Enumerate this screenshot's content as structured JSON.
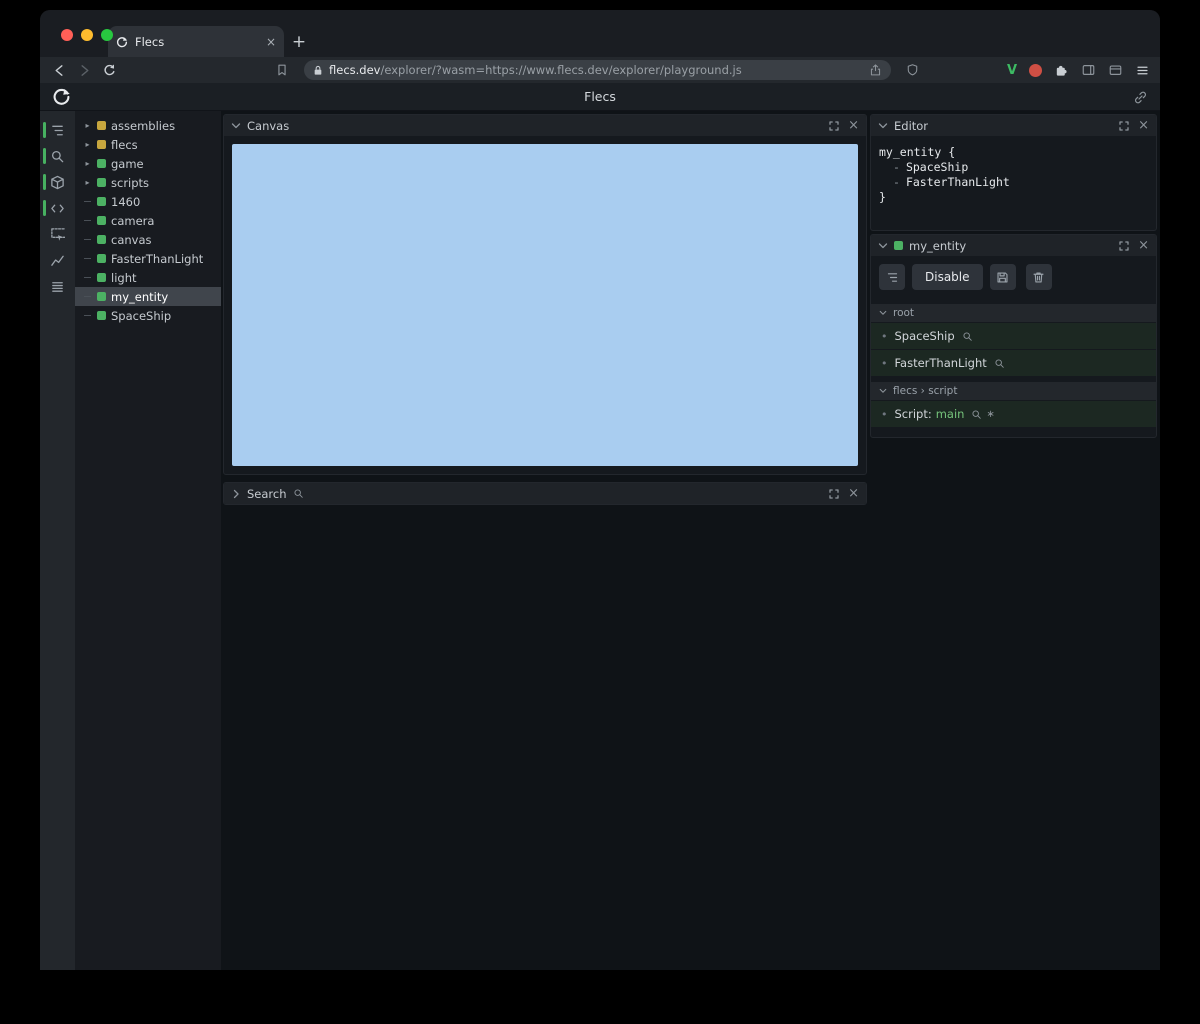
{
  "icons": {
    "close": "×",
    "new_tab": "+",
    "bullet": "•",
    "asterisk": "∗",
    "chevron_right": "›",
    "chevron_down": "⌄"
  },
  "browser": {
    "tab_title": "Flecs",
    "url_domain": "flecs.dev",
    "url_rest": "/explorer/?wasm=https://www.flecs.dev/explorer/playground.js"
  },
  "app": {
    "title": "Flecs"
  },
  "tree": {
    "items": [
      {
        "label": "assemblies",
        "color": "#c7a63e",
        "expandable": true
      },
      {
        "label": "flecs",
        "color": "#c7a63e",
        "expandable": true
      },
      {
        "label": "game",
        "color": "#4cb163",
        "expandable": true
      },
      {
        "label": "scripts",
        "color": "#4cb163",
        "expandable": true
      },
      {
        "label": "1460",
        "color": "#4cb163",
        "expandable": false
      },
      {
        "label": "camera",
        "color": "#4cb163",
        "expandable": false
      },
      {
        "label": "canvas",
        "color": "#4cb163",
        "expandable": false
      },
      {
        "label": "FasterThanLight",
        "color": "#4cb163",
        "expandable": false
      },
      {
        "label": "light",
        "color": "#4cb163",
        "expandable": false
      },
      {
        "label": "my_entity",
        "color": "#4cb163",
        "expandable": false,
        "selected": true
      },
      {
        "label": "SpaceShip",
        "color": "#4cb163",
        "expandable": false
      }
    ]
  },
  "canvas_panel": {
    "title": "Canvas",
    "fill": "#a9cdf0"
  },
  "search_panel": {
    "title": "Search"
  },
  "editor_panel": {
    "title": "Editor",
    "code": {
      "open": "my_entity {",
      "dash": "-",
      "items": [
        "SpaceShip",
        "FasterThanLight"
      ],
      "close": "}"
    }
  },
  "inspector_panel": {
    "title": "my_entity",
    "entity_color": "#4cb163",
    "disable_label": "Disable",
    "section_root": "root",
    "root_items": [
      "SpaceShip",
      "FasterThanLight"
    ],
    "section_script": "flecs › script",
    "script_prefix": "Script:",
    "script_name": "main"
  },
  "colors": {
    "accent_green": "#4cb163",
    "accent_yellow": "#c7a63e",
    "canvas_blue": "#a9cdf0"
  }
}
